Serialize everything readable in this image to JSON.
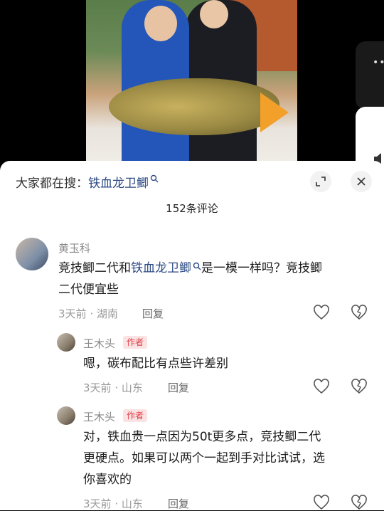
{
  "search_bar": {
    "prefix": "大家都在搜：",
    "term": "铁血龙卫鲫"
  },
  "comment_count": "152条评论",
  "comments": [
    {
      "user": "黄玉科",
      "text_before": "竞技鲫二代和",
      "link": "铁血龙卫鲫",
      "text_after": "是一模一样吗？竞技鲫",
      "text_line2": "二代便宜些",
      "time": "3天前",
      "location": "湖南",
      "reply": "回复"
    },
    {
      "user": "王木头",
      "badge": "作者",
      "text": "嗯，碳布配比有点些许差别",
      "time": "3天前",
      "location": "山东",
      "reply": "回复"
    },
    {
      "user": "王木头",
      "badge": "作者",
      "text_line1": "对，铁血贵一点因为50t更多点，竞技鲫二代",
      "text_line2": "更硬点。如果可以两个一起到手对比试试，选",
      "text_line3": "你喜欢的",
      "time": "3天前",
      "location": "山东",
      "reply": "回复"
    }
  ],
  "separator": " · "
}
